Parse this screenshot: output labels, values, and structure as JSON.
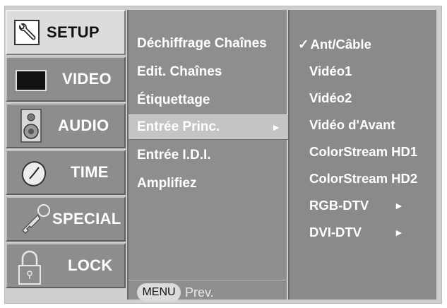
{
  "tabs": [
    {
      "label": "SETUP",
      "icon": "setup-icon",
      "active": true
    },
    {
      "label": "VIDEO",
      "icon": "video-icon",
      "active": false
    },
    {
      "label": "AUDIO",
      "icon": "speaker-icon",
      "active": false
    },
    {
      "label": "TIME",
      "icon": "clock-icon",
      "active": false
    },
    {
      "label": "SPECIAL",
      "icon": "key-icon",
      "active": false
    },
    {
      "label": "LOCK",
      "icon": "lock-icon",
      "active": false
    }
  ],
  "menu": {
    "items": [
      {
        "label": "Déchiffrage Chaînes"
      },
      {
        "label": "Edit. Chaînes"
      },
      {
        "label": "Étiquettage"
      },
      {
        "label": "Entrée Princ.",
        "selected": true,
        "arrow": "►"
      },
      {
        "label": "Entrée I.D.I."
      },
      {
        "label": "Amplifiez"
      }
    ],
    "menu_button": "MENU",
    "prev_label": "Prev."
  },
  "submenu": {
    "items": [
      {
        "label": "Ant/Câble",
        "checked": true,
        "check": "✓"
      },
      {
        "label": "Vidéo1"
      },
      {
        "label": "Vidéo2"
      },
      {
        "label": "Vidéo d'Avant"
      },
      {
        "label": "ColorStream HD1"
      },
      {
        "label": "ColorStream HD2"
      },
      {
        "label": "RGB-DTV",
        "arrow": "►"
      },
      {
        "label": "DVI-DTV",
        "arrow": "►"
      }
    ]
  },
  "colors": {
    "frame": "#cfcfcf",
    "tab": "#8d8d8d",
    "tab_active": "#dcdcdc",
    "menu": "#8e8e8e",
    "menu_selected": "#c4c4c4",
    "submenu": "#8a8a8a"
  }
}
